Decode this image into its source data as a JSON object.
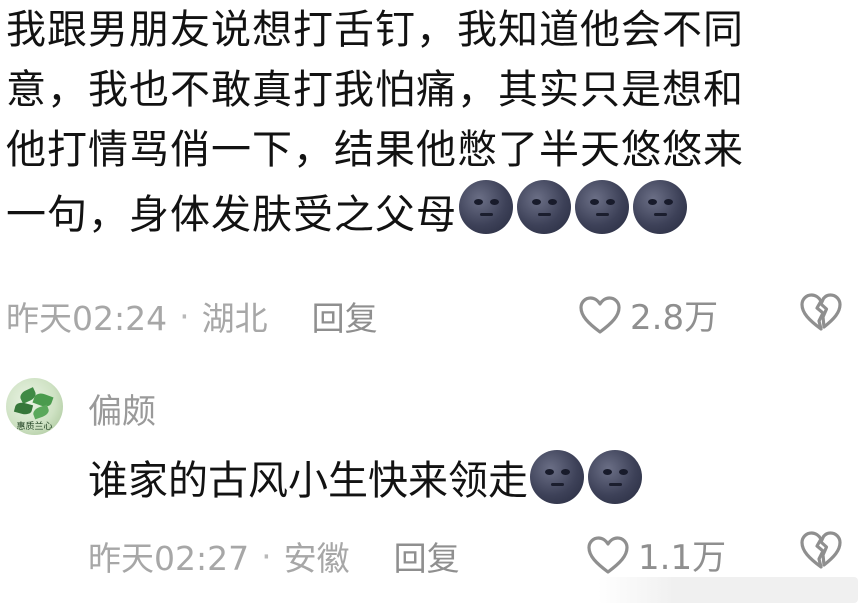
{
  "main_comment": {
    "lines": [
      "我跟男朋友说想打舌钉，我知道他会不同",
      "意，我也不敢真打我怕痛，其实只是想和",
      "他打情骂俏一下，结果他憋了半天悠悠来",
      "一句，身体发肤受之父母"
    ],
    "emoji_count": 4,
    "emoji_icon": "new-moon-face-emoji",
    "meta": {
      "time": "昨天02:24",
      "separator": "·",
      "location": "湖北",
      "reply_label": "回复"
    },
    "likes": "2.8万"
  },
  "reply_comment": {
    "username": "偏颇",
    "avatar_caption": "惠质兰心",
    "text": "谁家的古风小生快来领走",
    "emoji_count": 2,
    "emoji_icon": "new-moon-face-emoji",
    "meta": {
      "time": "昨天02:27",
      "separator": "·",
      "location": "安徽",
      "reply_label": "回复"
    },
    "likes": "1.1万"
  },
  "icons": {
    "like": "heart-outline-icon",
    "dislike": "broken-heart-icon"
  },
  "colors": {
    "text": "#121212",
    "meta": "#a7a7a7",
    "icon": "#8f8f8f",
    "moon_emoji": "#3d4158"
  }
}
